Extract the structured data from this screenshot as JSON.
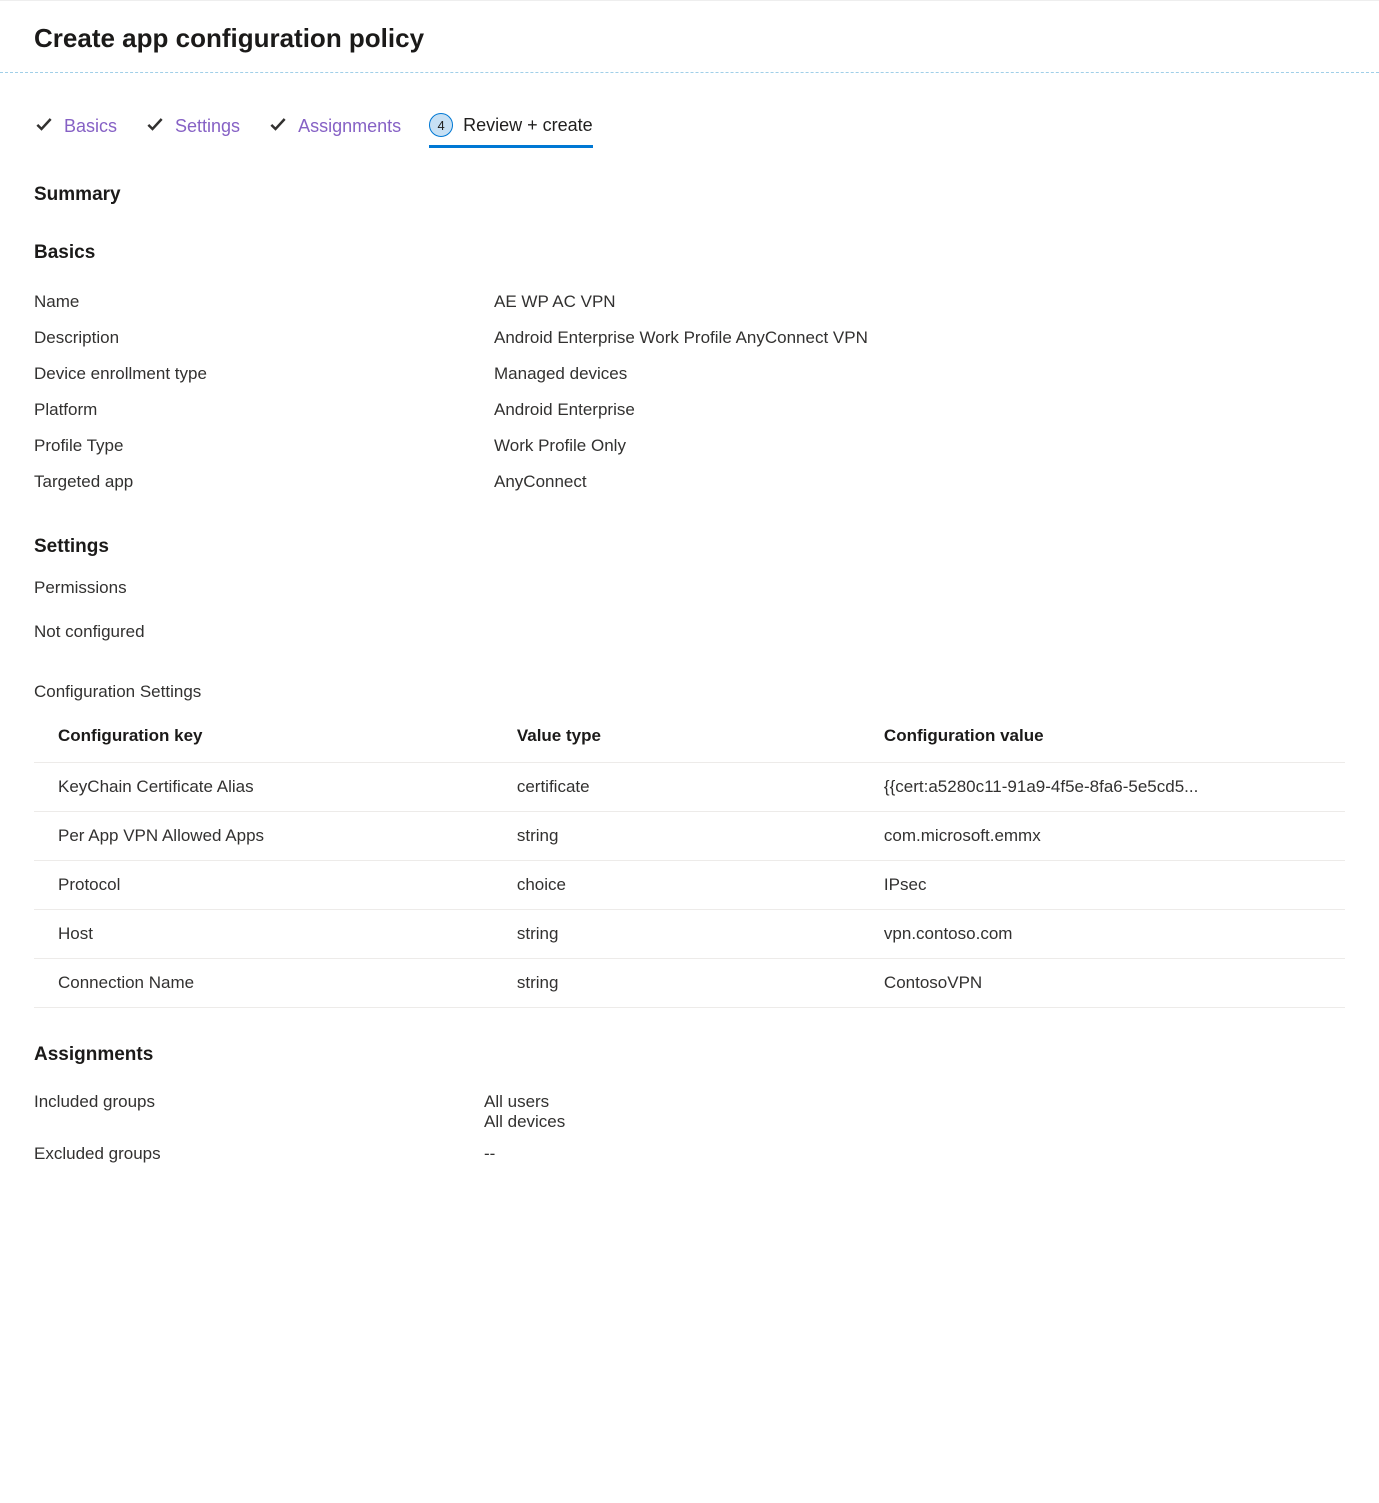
{
  "header": {
    "title": "Create app configuration policy"
  },
  "tabs": [
    {
      "label": "Basics",
      "completed": true,
      "active": false
    },
    {
      "label": "Settings",
      "completed": true,
      "active": false
    },
    {
      "label": "Assignments",
      "completed": true,
      "active": false
    },
    {
      "label": "Review + create",
      "completed": false,
      "active": true,
      "step": "4"
    }
  ],
  "summary_label": "Summary",
  "basics": {
    "heading": "Basics",
    "fields": [
      {
        "label": "Name",
        "value": "AE WP AC VPN"
      },
      {
        "label": "Description",
        "value": "Android Enterprise Work Profile AnyConnect VPN"
      },
      {
        "label": "Device enrollment type",
        "value": "Managed devices"
      },
      {
        "label": "Platform",
        "value": "Android Enterprise"
      },
      {
        "label": "Profile Type",
        "value": "Work Profile Only"
      },
      {
        "label": "Targeted app",
        "value": "AnyConnect"
      }
    ]
  },
  "settings": {
    "heading": "Settings",
    "permissions_label": "Permissions",
    "not_configured": "Not configured",
    "config_settings_label": "Configuration Settings",
    "table": {
      "headers": [
        "Configuration key",
        "Value type",
        "Configuration value"
      ],
      "rows": [
        {
          "key": "KeyChain Certificate Alias",
          "type": "certificate",
          "value": "{{cert:a5280c11-91a9-4f5e-8fa6-5e5cd5..."
        },
        {
          "key": "Per App VPN Allowed Apps",
          "type": "string",
          "value": "com.microsoft.emmx"
        },
        {
          "key": "Protocol",
          "type": "choice",
          "value": "IPsec"
        },
        {
          "key": "Host",
          "type": "string",
          "value": "vpn.contoso.com"
        },
        {
          "key": "Connection Name",
          "type": "string",
          "value": "ContosoVPN"
        }
      ]
    }
  },
  "assignments": {
    "heading": "Assignments",
    "included_label": "Included groups",
    "included_values": [
      "All users",
      "All devices"
    ],
    "excluded_label": "Excluded groups",
    "excluded_value": "--"
  }
}
